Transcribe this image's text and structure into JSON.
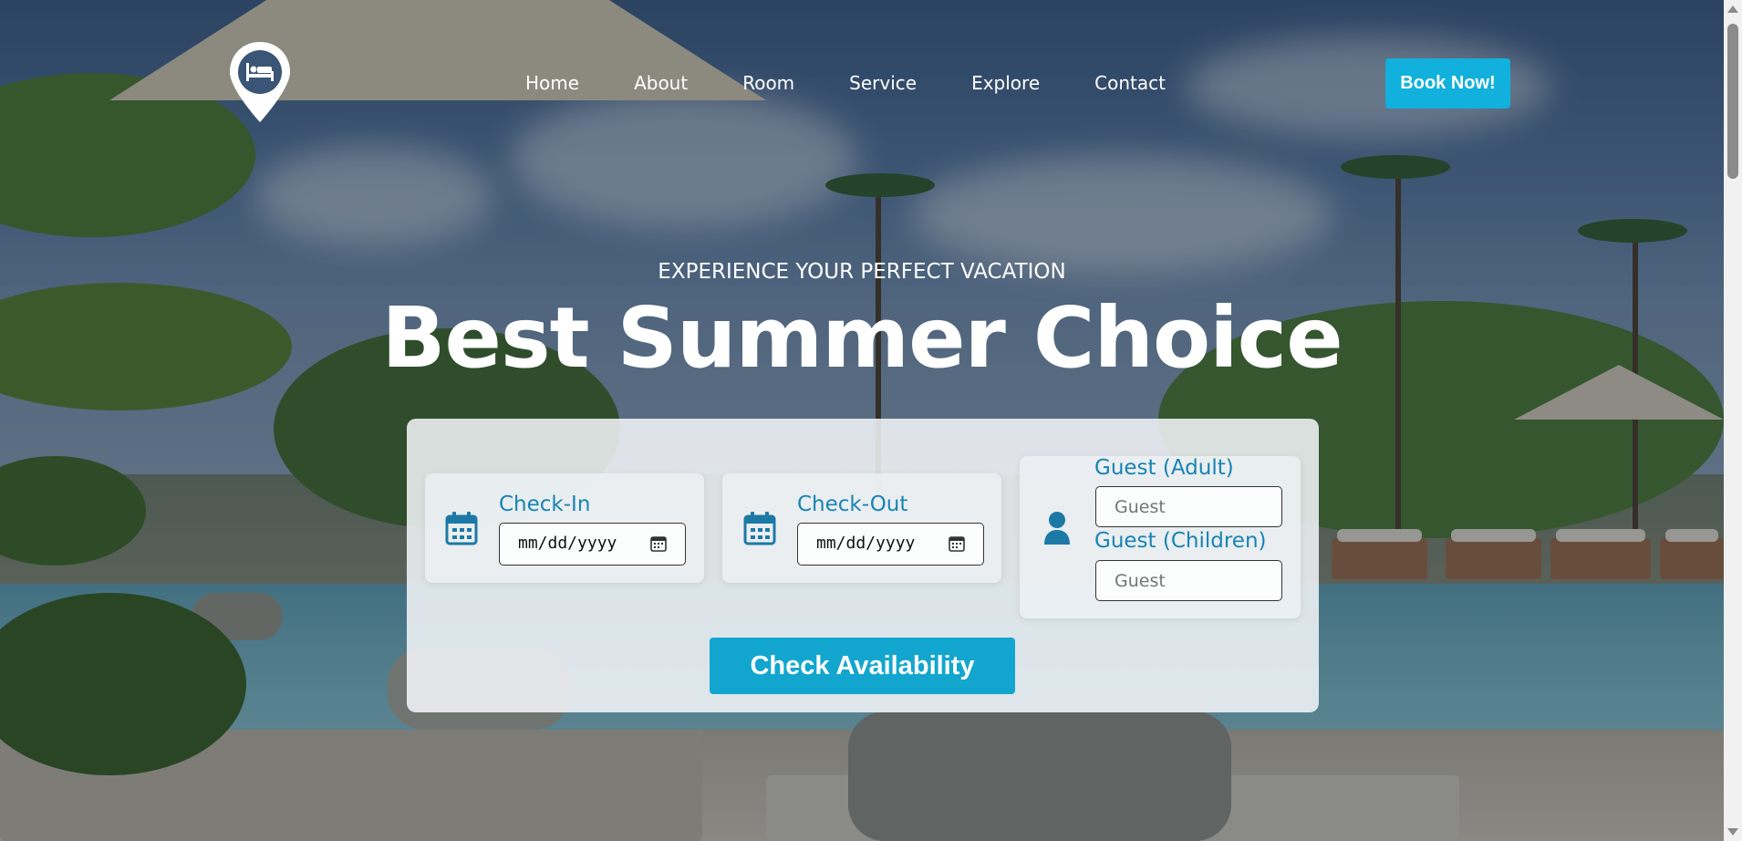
{
  "nav": {
    "items": [
      "Home",
      "About",
      "Room",
      "Service",
      "Explore",
      "Contact"
    ],
    "book_label": "Book Now!"
  },
  "hero": {
    "subtitle": "EXPERIENCE YOUR PERFECT VACATION",
    "title": "Best Summer Choice"
  },
  "booking": {
    "checkin_label": "Check-In",
    "checkin_value": "mm/dd/yyyy",
    "checkout_label": "Check-Out",
    "checkout_value": "mm/dd/yyyy",
    "adult_label": "Guest (Adult)",
    "adult_placeholder": "Guest",
    "children_label": "Guest (Children)",
    "children_placeholder": "Guest",
    "submit_label": "Check Availability"
  },
  "icons": {
    "logo": "hotel-bed-pin-icon",
    "checkin": "calendar-icon",
    "checkout": "calendar-icon",
    "guest": "person-icon",
    "date_picker": "calendar-picker-icon"
  },
  "colors": {
    "accent": "#12b0dc",
    "label": "#1883b4",
    "icon": "#1c79a6"
  }
}
